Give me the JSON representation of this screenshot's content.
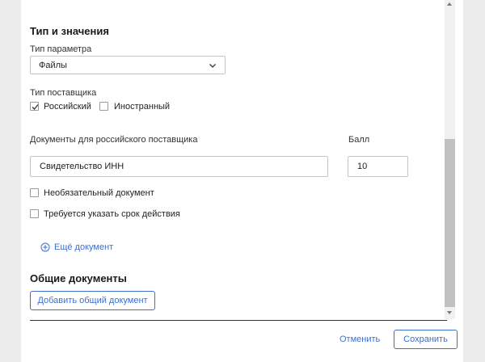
{
  "section": {
    "title": "Тип и значения"
  },
  "param_type": {
    "label": "Тип параметра",
    "value": "Файлы"
  },
  "supplier_type": {
    "label": "Тип поставщика",
    "options": [
      {
        "label": "Российский",
        "checked": true
      },
      {
        "label": "Иностранный",
        "checked": false
      }
    ]
  },
  "documents": {
    "label": "Документы для российского поставщика",
    "score_label": "Балл",
    "document_value": "Свидетельство ИНН",
    "score_value": "10",
    "optional_label": "Необязательный документ",
    "validity_label": "Требуется указать срок действия",
    "add_more_label": "Ещё документ"
  },
  "common_documents": {
    "title": "Общие документы",
    "add_button": "Добавить общий документ"
  },
  "footer": {
    "cancel": "Отменить",
    "save": "Сохранить"
  },
  "colors": {
    "accent": "#3d6fd1",
    "background": "#ececec",
    "panel": "#ffffff"
  }
}
